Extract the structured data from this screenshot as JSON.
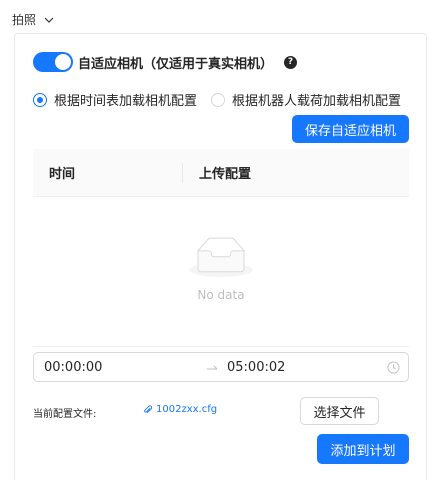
{
  "section": {
    "title": "拍照"
  },
  "adaptive": {
    "switch_on": true,
    "label": "自适应相机（仅适用于真实相机）",
    "help_glyph": "?"
  },
  "radios": [
    {
      "label": "根据时间表加载相机配置",
      "checked": true
    },
    {
      "label": "根据机器人载荷加载相机配置",
      "checked": false
    }
  ],
  "buttons": {
    "save_adaptive": "保存自适应相机",
    "choose_file": "选择文件",
    "add_to_plan": "添加到计划"
  },
  "table": {
    "columns": [
      "时间",
      "上传配置"
    ],
    "rows": [],
    "empty_text": "No data"
  },
  "time_range": {
    "start": "00:00:00",
    "end": "05:00:02"
  },
  "config_file": {
    "label": "当前配置文件:",
    "name": "1002zxx.cfg"
  },
  "colors": {
    "primary": "#1677ff",
    "border": "#d9d9d9",
    "header_bg": "#fafafa",
    "empty_text": "#bfbfbf"
  }
}
